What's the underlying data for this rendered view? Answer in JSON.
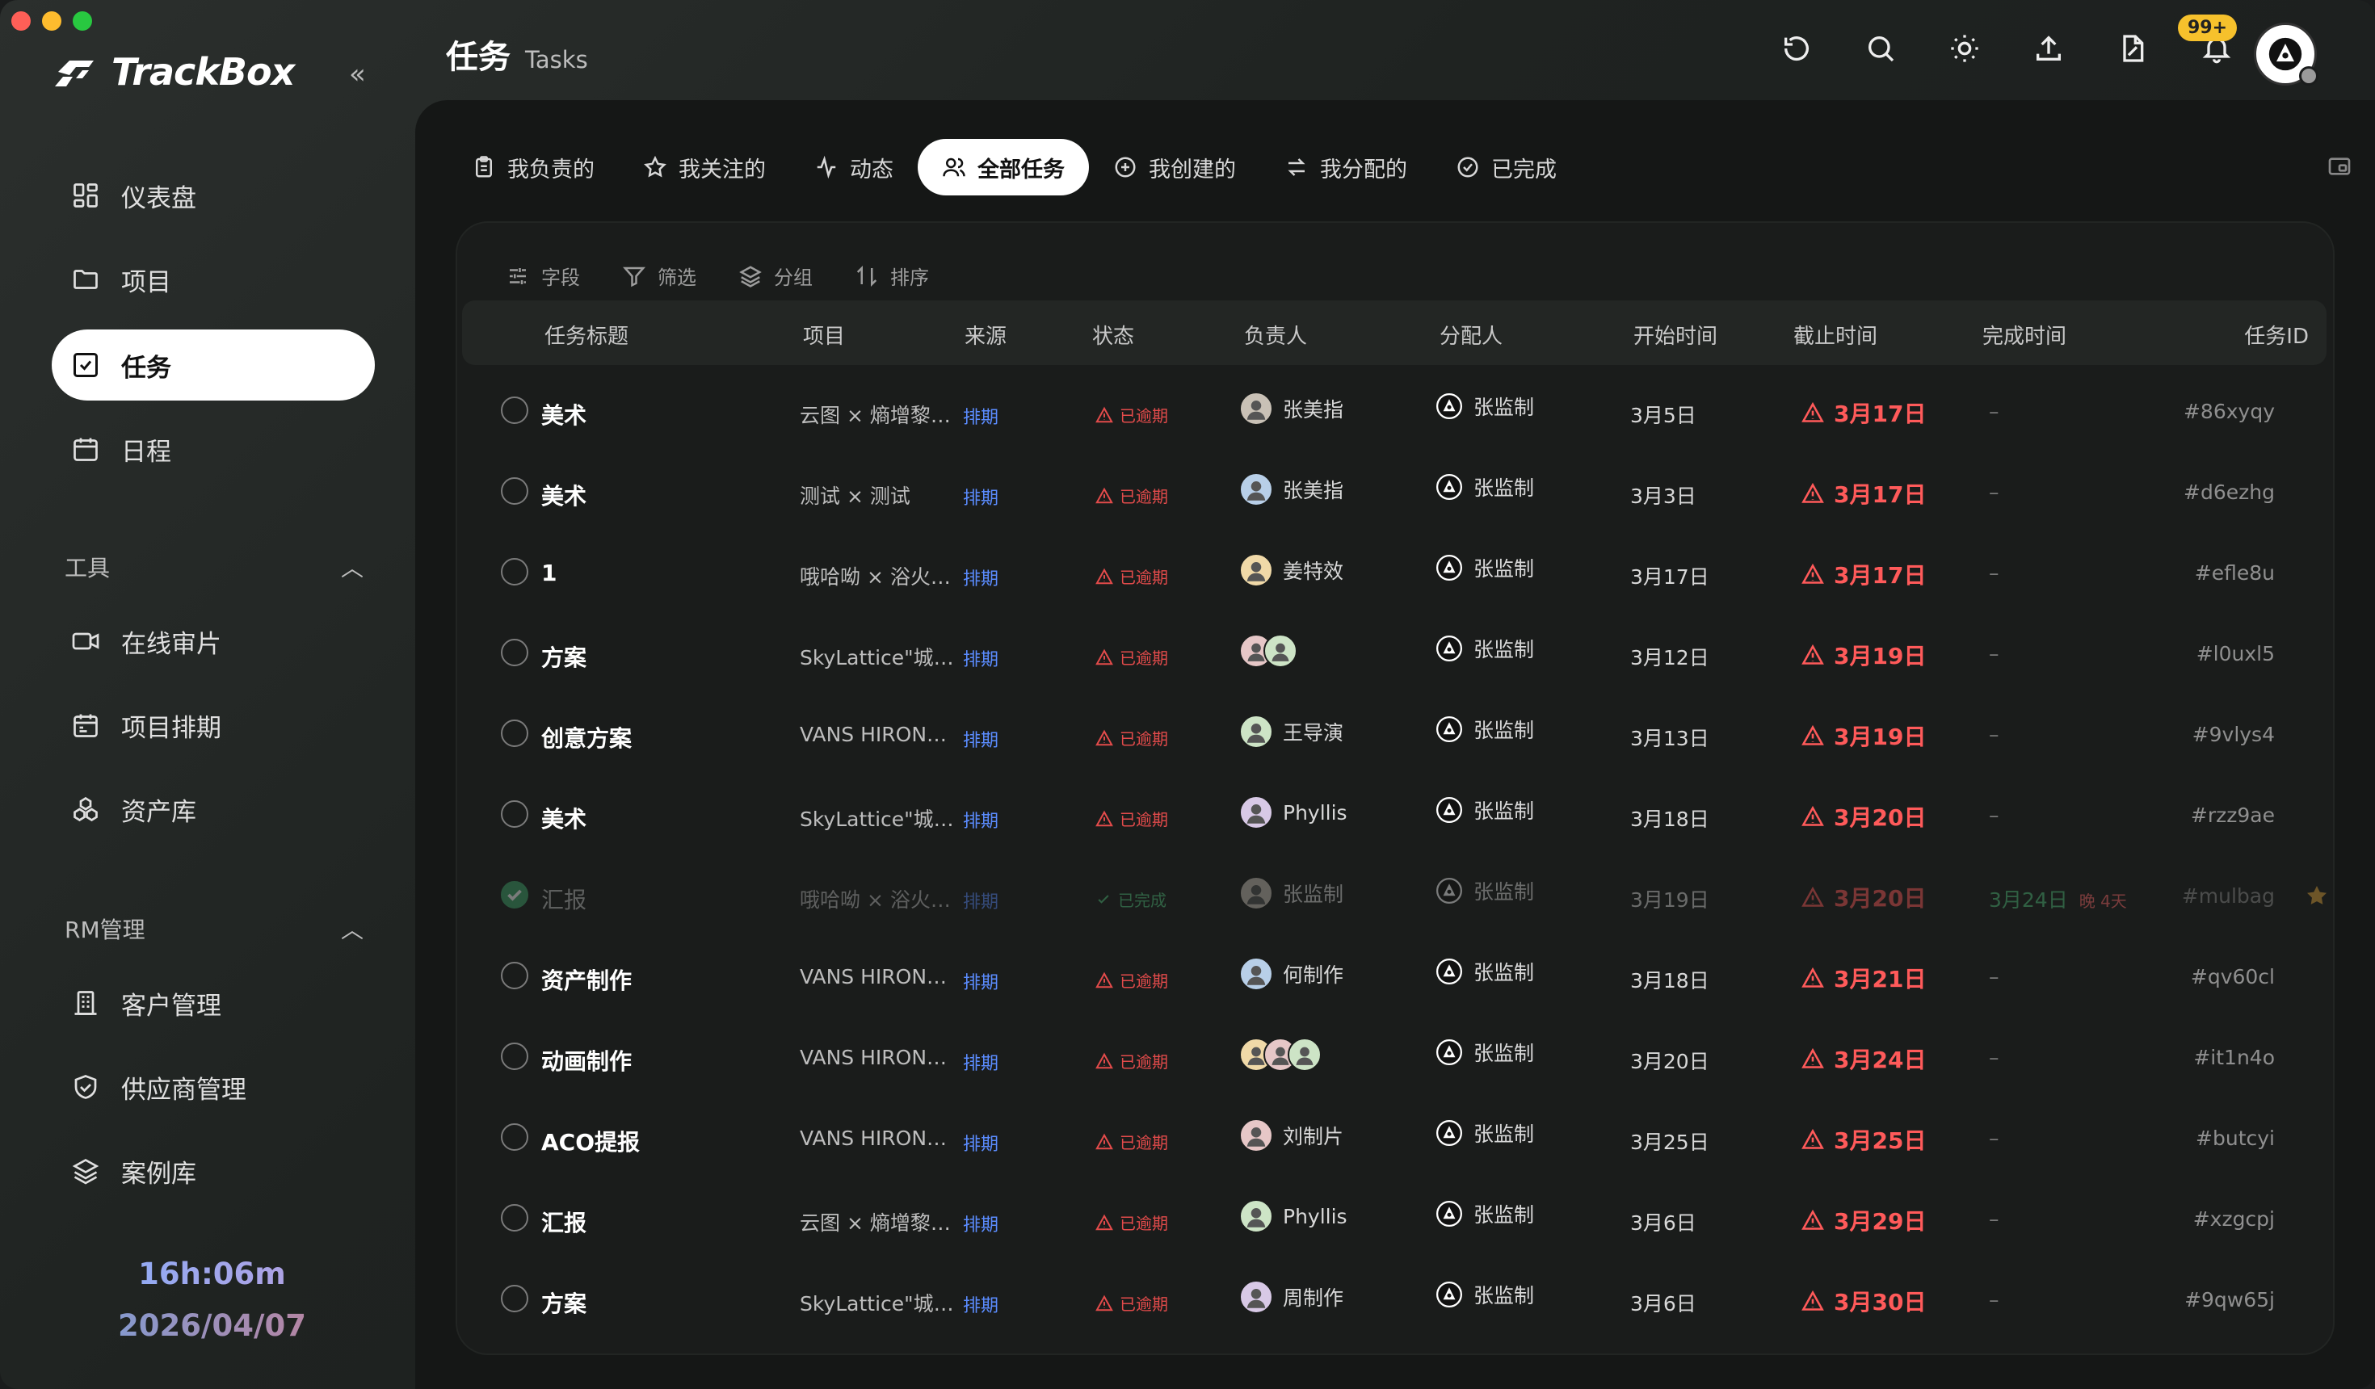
{
  "app": {
    "name": "TrackBox"
  },
  "sidebar": {
    "items": [
      {
        "label": "仪表盘",
        "icon": "dashboard-icon"
      },
      {
        "label": "项目",
        "icon": "folder-icon"
      },
      {
        "label": "任务",
        "icon": "task-check-icon",
        "active": true
      },
      {
        "label": "日程",
        "icon": "calendar-icon"
      }
    ],
    "tools_title": "工具",
    "tools": [
      {
        "label": "在线审片",
        "icon": "video-icon"
      },
      {
        "label": "项目排期",
        "icon": "schedule-icon"
      },
      {
        "label": "资产库",
        "icon": "assets-icon"
      }
    ],
    "rm_title": "RM管理",
    "rm": [
      {
        "label": "客户管理",
        "icon": "client-icon"
      },
      {
        "label": "供应商管理",
        "icon": "supplier-icon"
      },
      {
        "label": "案例库",
        "icon": "layers-icon"
      }
    ],
    "clock_time": "16h:06m",
    "clock_date": "2026/04/07"
  },
  "header": {
    "title_zh": "任务",
    "title_en": "Tasks",
    "notification_count": "99+"
  },
  "tabs": [
    {
      "label": "我负责的",
      "icon": "clipboard-icon"
    },
    {
      "label": "我关注的",
      "icon": "star-outline-icon"
    },
    {
      "label": "动态",
      "icon": "activity-icon"
    },
    {
      "label": "全部任务",
      "icon": "users-icon",
      "active": true
    },
    {
      "label": "我创建的",
      "icon": "plus-circle-icon"
    },
    {
      "label": "我分配的",
      "icon": "swap-icon"
    },
    {
      "label": "已完成",
      "icon": "check-circle-icon"
    }
  ],
  "toolbar": [
    {
      "label": "字段",
      "icon": "sliders-icon"
    },
    {
      "label": "筛选",
      "icon": "filter-icon"
    },
    {
      "label": "分组",
      "icon": "layers-icon"
    },
    {
      "label": "排序",
      "icon": "sort-icon"
    }
  ],
  "columns": {
    "title": "任务标题",
    "project": "项目",
    "source": "来源",
    "status": "状态",
    "owner": "负责人",
    "assigner": "分配人",
    "start": "开始时间",
    "due": "截止时间",
    "finished": "完成时间",
    "id": "任务ID"
  },
  "rows": [
    {
      "title": "美术",
      "project": "云图 × 熵增黎…",
      "source": "排期",
      "status": "已逾期",
      "owner": "张美指",
      "assigner": "张监制",
      "start": "3月5日",
      "due": "3月17日",
      "finished": "–",
      "id": "#86xyqy"
    },
    {
      "title": "美术",
      "project": "测试 × 测试",
      "source": "排期",
      "status": "已逾期",
      "owner": "张美指",
      "assigner": "张监制",
      "start": "3月3日",
      "due": "3月17日",
      "finished": "–",
      "id": "#d6ezhg"
    },
    {
      "title": "1",
      "project": "哦哈呦 × 浴火…",
      "source": "排期",
      "status": "已逾期",
      "owner": "姜特效",
      "assigner": "张监制",
      "start": "3月17日",
      "due": "3月17日",
      "finished": "–",
      "id": "#efle8u"
    },
    {
      "title": "方案",
      "project": "SkyLattice\"城…",
      "source": "排期",
      "status": "已逾期",
      "owner": "",
      "assigner": "张监制",
      "start": "3月12日",
      "due": "3月19日",
      "finished": "–",
      "id": "#l0uxl5"
    },
    {
      "title": "创意方案",
      "project": "VANS HIRON…",
      "source": "排期",
      "status": "已逾期",
      "owner": "王导演",
      "assigner": "张监制",
      "start": "3月13日",
      "due": "3月19日",
      "finished": "–",
      "id": "#9vlys4"
    },
    {
      "title": "美术",
      "project": "SkyLattice\"城…",
      "source": "排期",
      "status": "已逾期",
      "owner": "Phyllis",
      "assigner": "张监制",
      "start": "3月18日",
      "due": "3月20日",
      "finished": "–",
      "id": "#rzz9ae"
    },
    {
      "title": "汇报",
      "project": "哦哈呦 × 浴火…",
      "source": "排期",
      "status": "已完成",
      "owner": "张监制",
      "assigner": "张监制",
      "start": "3月19日",
      "due": "3月20日",
      "finished": "3月24日",
      "late": "晚 4天",
      "id": "#mulbag",
      "completed": true
    },
    {
      "title": "资产制作",
      "project": "VANS HIRON…",
      "source": "排期",
      "status": "已逾期",
      "owner": "何制作",
      "assigner": "张监制",
      "start": "3月18日",
      "due": "3月21日",
      "finished": "–",
      "id": "#qv60cl"
    },
    {
      "title": "动画制作",
      "project": "VANS HIRON…",
      "source": "排期",
      "status": "已逾期",
      "owner": "",
      "assigner": "张监制",
      "start": "3月20日",
      "due": "3月24日",
      "finished": "–",
      "id": "#it1n4o"
    },
    {
      "title": "ACO提报",
      "project": "VANS HIRON…",
      "source": "排期",
      "status": "已逾期",
      "owner": "刘制片",
      "assigner": "张监制",
      "start": "3月25日",
      "due": "3月25日",
      "finished": "–",
      "id": "#butcyi"
    },
    {
      "title": "汇报",
      "project": "云图 × 熵增黎…",
      "source": "排期",
      "status": "已逾期",
      "owner": "Phyllis",
      "assigner": "张监制",
      "start": "3月6日",
      "due": "3月29日",
      "finished": "–",
      "id": "#xzgcpj"
    },
    {
      "title": "方案",
      "project": "SkyLattice\"城…",
      "source": "排期",
      "status": "已逾期",
      "owner": "周制作",
      "assigner": "张监制",
      "start": "3月6日",
      "due": "3月30日",
      "finished": "–",
      "id": "#9qw65j"
    }
  ]
}
